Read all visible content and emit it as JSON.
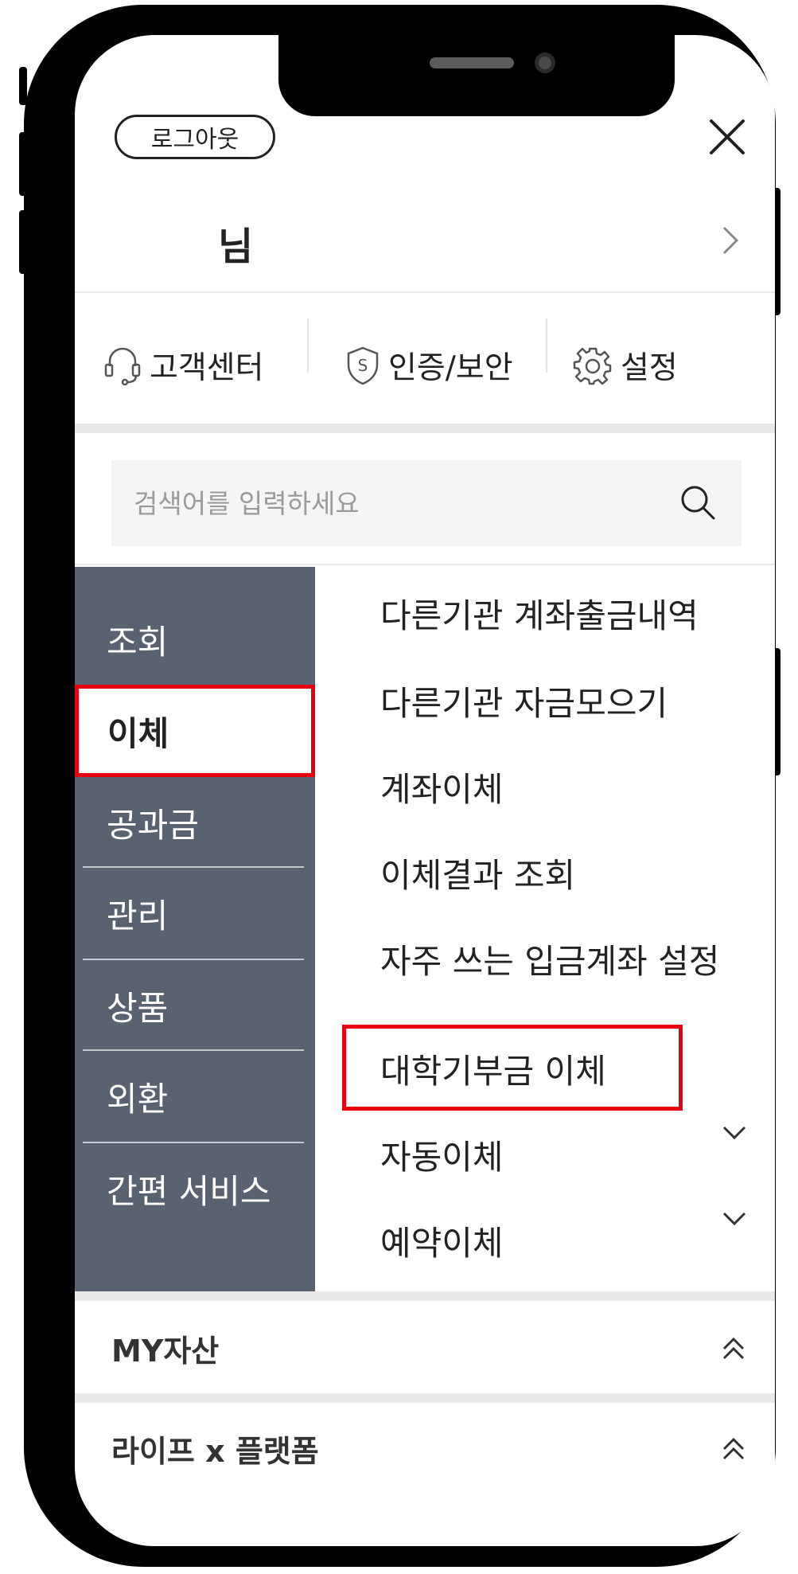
{
  "header": {
    "logout_label": "로그아웃",
    "user_name": "님"
  },
  "quick_links": [
    {
      "label": "고객센터",
      "icon": "headset-icon"
    },
    {
      "label": "인증/보안",
      "icon": "shield-icon"
    },
    {
      "label": "설정",
      "icon": "gear-icon"
    }
  ],
  "search": {
    "placeholder": "검색어를 입력하세요"
  },
  "left_menu": {
    "items": [
      "조회",
      "이체",
      "공과금",
      "관리",
      "상품",
      "외환",
      "간편 서비스"
    ],
    "active": "이체"
  },
  "sub_menu": {
    "items": [
      {
        "label": "다른기관 계좌출금내역",
        "expandable": false
      },
      {
        "label": "다른기관 자금모으기",
        "expandable": false
      },
      {
        "label": "계좌이체",
        "expandable": false
      },
      {
        "label": "이체결과 조회",
        "expandable": false
      },
      {
        "label": "자주 쓰는 입금계좌 설정",
        "expandable": false
      },
      {
        "label": "대학기부금 이체",
        "expandable": false,
        "highlighted": true
      },
      {
        "label": "자동이체",
        "expandable": true
      },
      {
        "label": "예약이체",
        "expandable": true
      }
    ]
  },
  "sections": [
    {
      "title": "MY자산"
    },
    {
      "title": "라이프 x 플랫폼"
    }
  ],
  "colors": {
    "menu_bg": "#586270",
    "highlight_red": "#e60012",
    "divider_gray": "#e9e9e9"
  }
}
